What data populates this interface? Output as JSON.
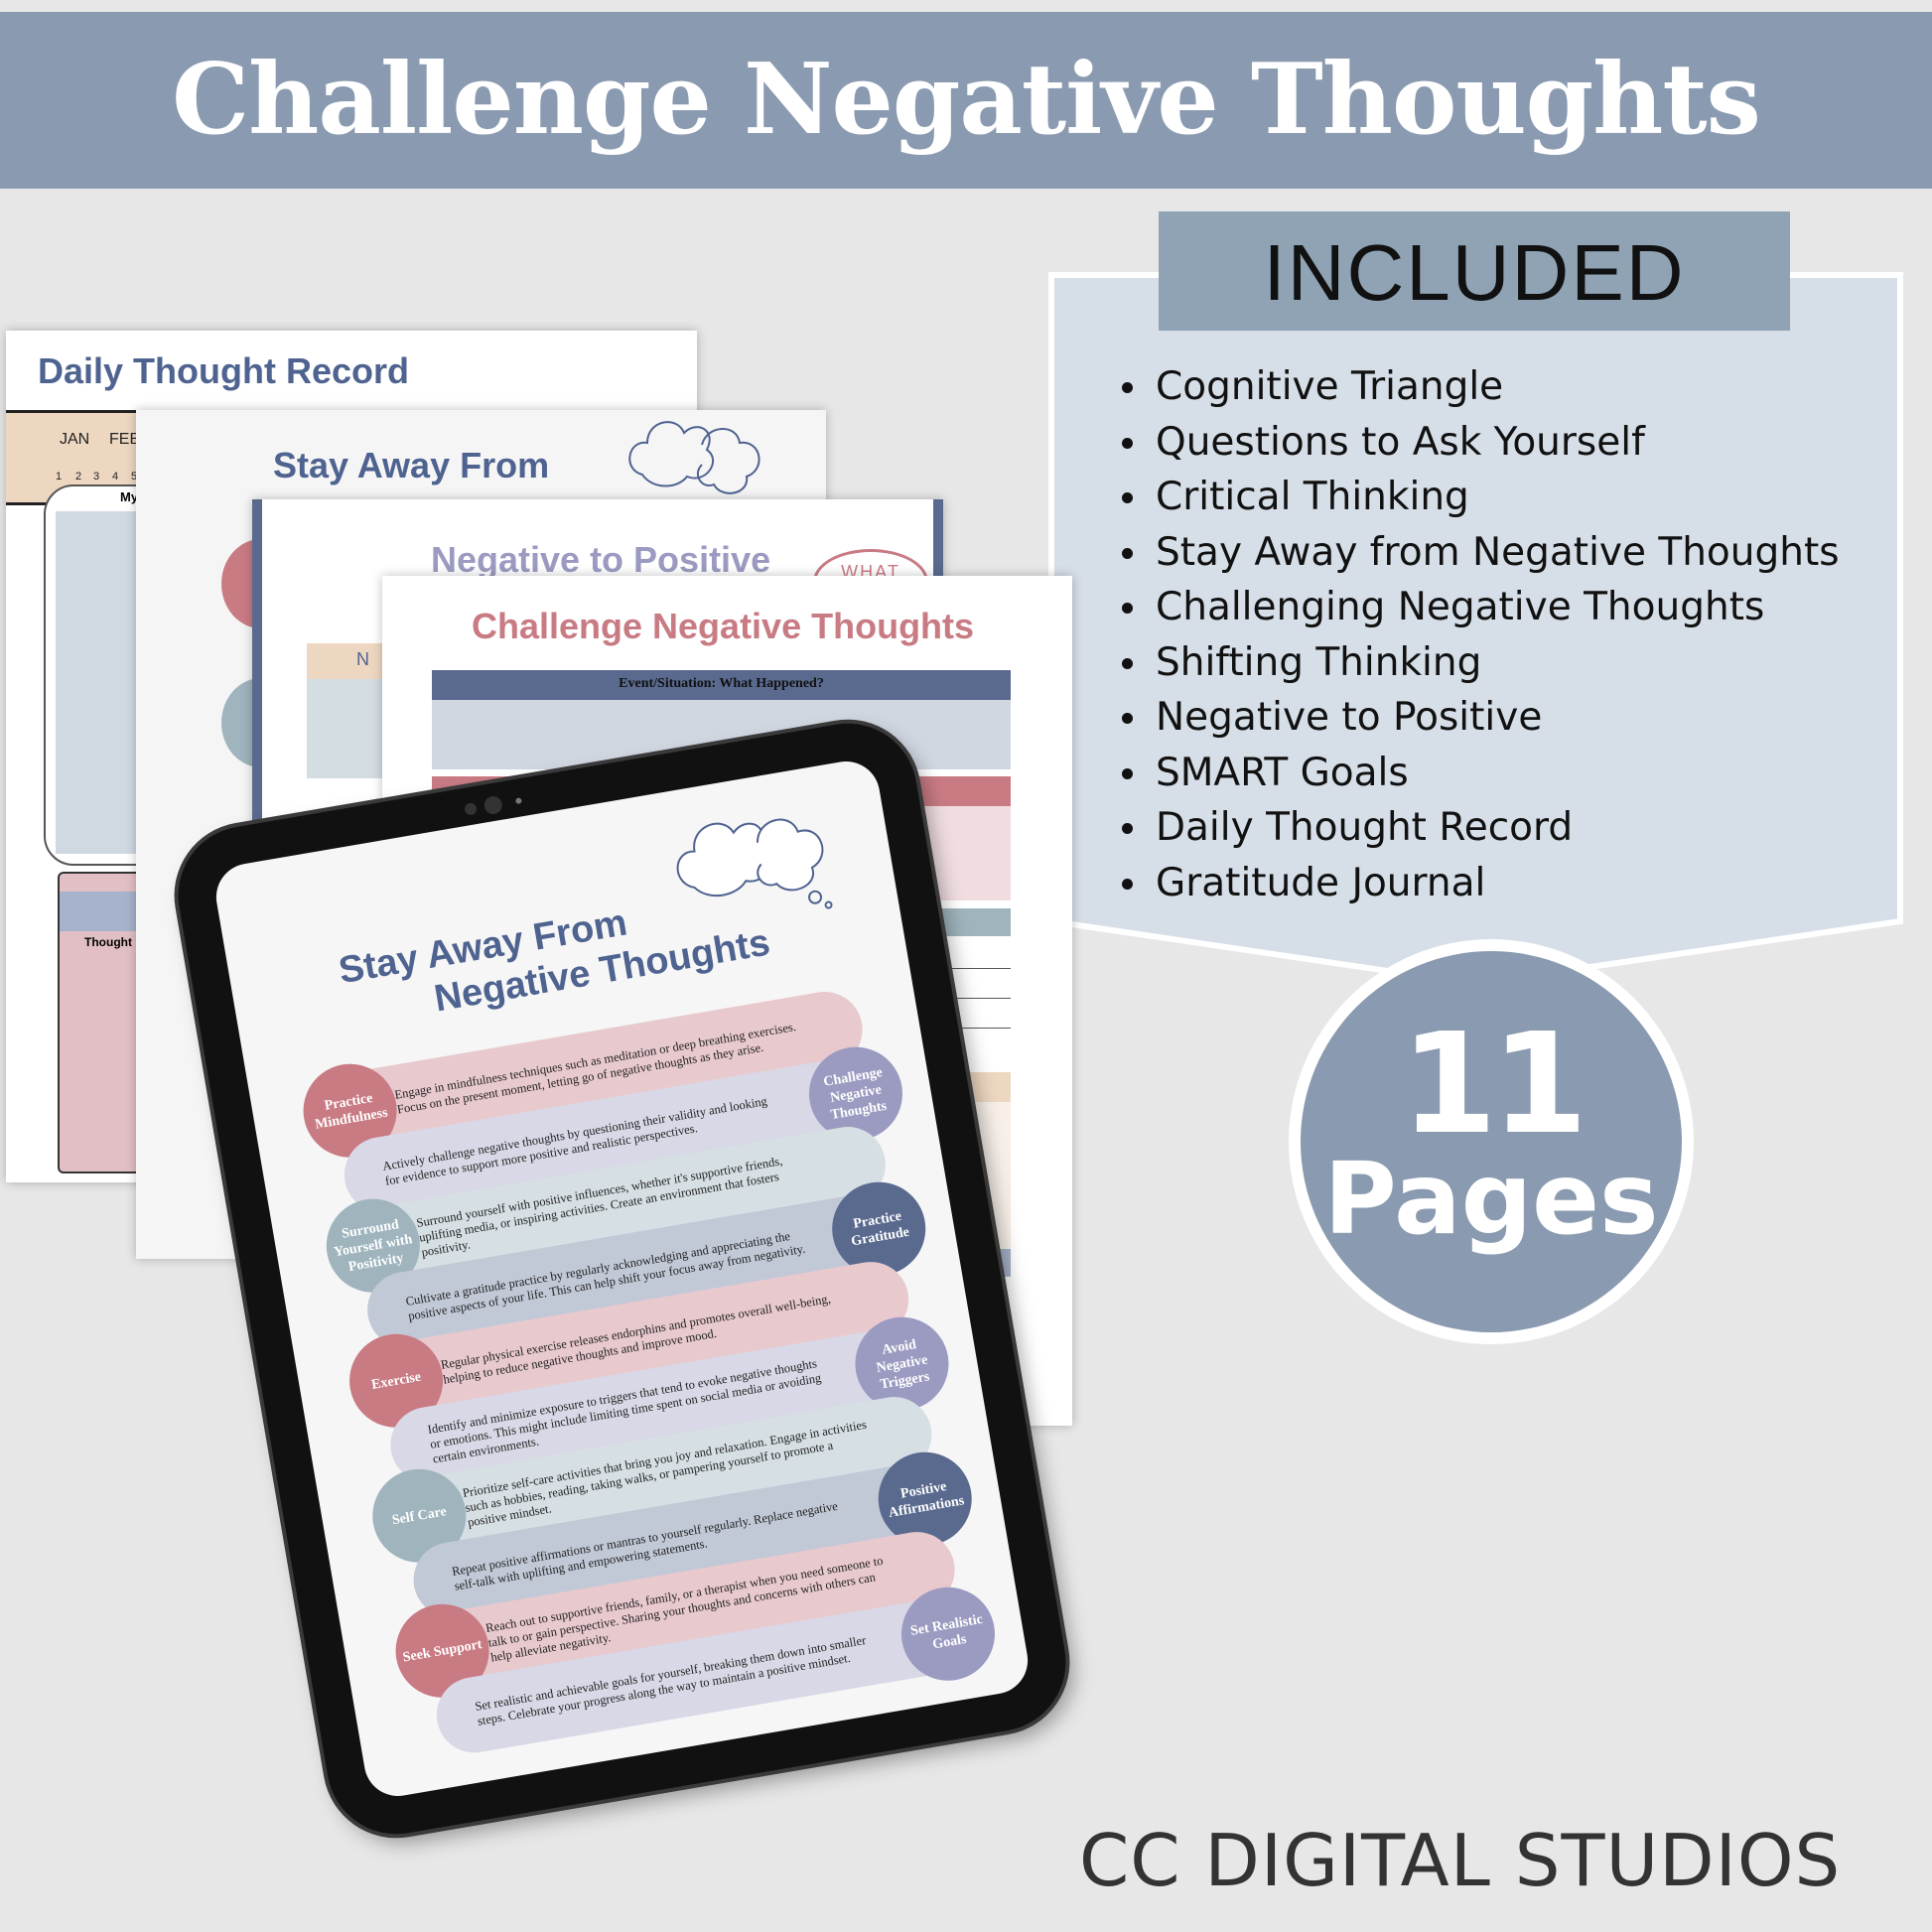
{
  "header": {
    "title": "Challenge Negative Thoughts"
  },
  "included": {
    "heading": "INCLUDED",
    "items": [
      "Cognitive Triangle",
      "Questions to Ask Yourself",
      "Critical Thinking",
      "Stay Away from Negative Thoughts",
      "Challenging Negative Thoughts",
      "Shifting Thinking",
      "Negative to Positive",
      "SMART Goals",
      "Daily Thought Record",
      "Gratitude Journal"
    ]
  },
  "badge": {
    "count": "11",
    "unit": "Pages"
  },
  "brand": "CC DIGITAL STUDIOS",
  "colors": {
    "header": "#8a9ab0",
    "panel": "#d6dee7",
    "included_box": "#8fa3b4",
    "pink": "#c97b84",
    "lavender": "#9b9bc2",
    "teal": "#9fb4bd",
    "slate": "#5a6a8e"
  },
  "pages": {
    "daily": {
      "title": "Daily Thought Record",
      "months": [
        "JAN",
        "FEB"
      ],
      "days": [
        "1",
        "2",
        "3",
        "4",
        "5"
      ],
      "box_label": "My",
      "box2_label": "Thought"
    },
    "stay_away": {
      "title": "Stay Away From"
    },
    "neg_pos": {
      "title": "Negative to Positive",
      "badge": "WHAT",
      "band": "N"
    },
    "challenge": {
      "title": "Challenge Negative Thoughts",
      "header": "Event/Situation: What Happened?"
    }
  },
  "tablet": {
    "title_line1": "Stay Away From",
    "title_line2": "Negative Thoughts",
    "rows": [
      {
        "label": "Practice Mindfulness",
        "text": "Engage in mindfulness techniques such as meditation or deep breathing exercises. Focus on the present moment, letting go of negative thoughts as they arise.",
        "theme": "pink",
        "side": "left"
      },
      {
        "label": "Challenge Negative Thoughts",
        "text": "Actively challenge negative thoughts by questioning their validity and looking for evidence to support more positive and realistic perspectives.",
        "theme": "lavender",
        "side": "right"
      },
      {
        "label": "Surround Yourself with Positivity",
        "text": "Surround yourself with positive influences, whether it's supportive friends, uplifting media, or inspiring activities. Create an environment that fosters positivity.",
        "theme": "teal",
        "side": "left"
      },
      {
        "label": "Practice Gratitude",
        "text": "Cultivate a gratitude practice by regularly acknowledging and appreciating the positive aspects of your life. This can help shift your focus away from negativity.",
        "theme": "slate",
        "side": "right"
      },
      {
        "label": "Exercise",
        "text": "Regular physical exercise releases endorphins and promotes overall well-being, helping to reduce negative thoughts and improve mood.",
        "theme": "pink",
        "side": "left"
      },
      {
        "label": "Avoid Negative Triggers",
        "text": "Identify and minimize exposure to triggers that tend to evoke negative thoughts or emotions. This might include limiting time spent on social media or avoiding certain environments.",
        "theme": "lavender",
        "side": "right"
      },
      {
        "label": "Self Care",
        "text": "Prioritize self-care activities that bring you joy and relaxation. Engage in activities such as hobbies, reading, taking walks, or pampering yourself to promote a positive mindset.",
        "theme": "teal",
        "side": "left"
      },
      {
        "label": "Positive Affirmations",
        "text": "Repeat positive affirmations or mantras to yourself regularly. Replace negative self-talk with uplifting and empowering statements.",
        "theme": "slate",
        "side": "right"
      },
      {
        "label": "Seek Support",
        "text": "Reach out to supportive friends, family, or a therapist when you need someone to talk to or gain perspective. Sharing your thoughts and concerns with others can help alleviate negativity.",
        "theme": "pink",
        "side": "left"
      },
      {
        "label": "Set Realistic Goals",
        "text": "Set realistic and achievable goals for yourself, breaking them down into smaller steps. Celebrate your progress along the way to maintain a positive mindset.",
        "theme": "lavender",
        "side": "right"
      }
    ]
  }
}
